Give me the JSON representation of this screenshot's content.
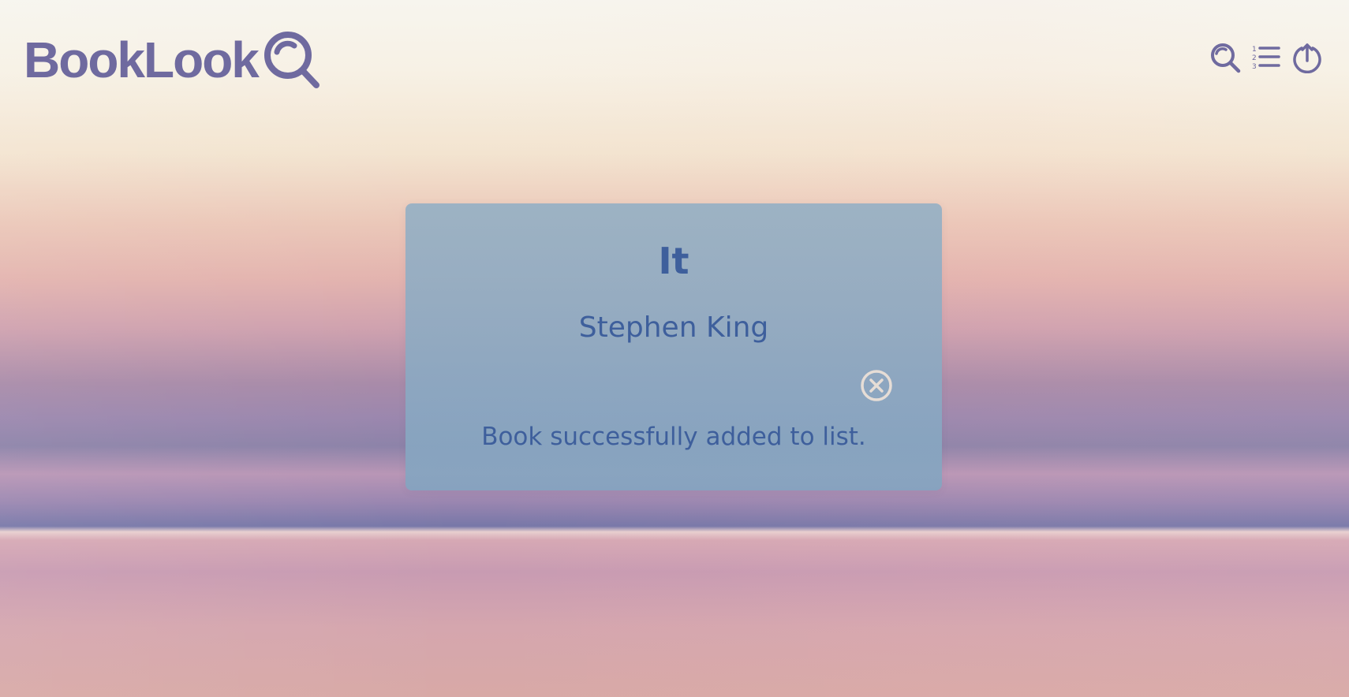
{
  "app": {
    "logo_text": "BookLook",
    "brand_color": "#6f6a9f"
  },
  "toolbar": {
    "items": [
      {
        "name": "search",
        "icon": "search-icon"
      },
      {
        "name": "list",
        "icon": "numbered-list-icon"
      },
      {
        "name": "logout",
        "icon": "power-icon"
      }
    ]
  },
  "modal": {
    "title": "It",
    "author": "Stephen King",
    "message": "Book successfully added to list.",
    "close_icon": "close-circle-icon",
    "text_color": "#3e5f9c",
    "background_color": "#8fa9c2"
  }
}
